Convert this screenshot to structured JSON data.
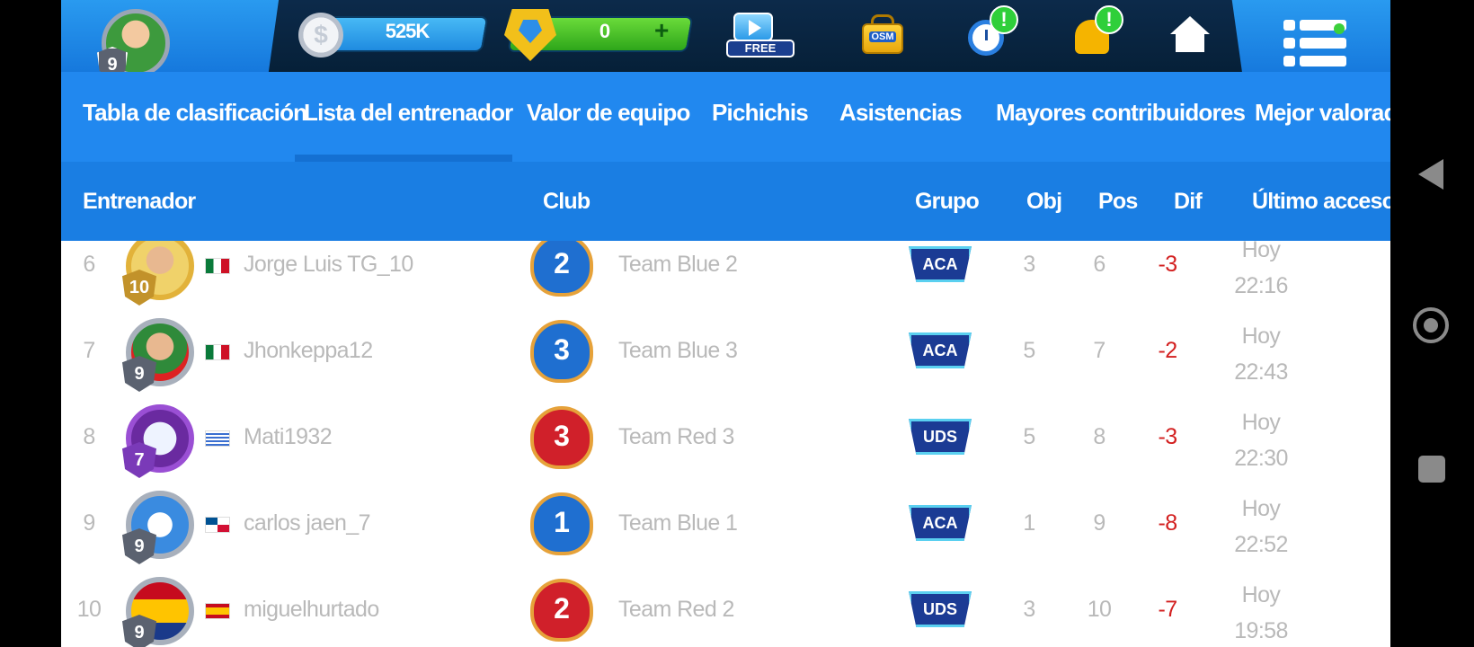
{
  "topbar": {
    "level": "9",
    "coins": "525K",
    "tokens": "0",
    "tokens_plus": "+",
    "free_label": "FREE",
    "osm_label": "OSM",
    "timer_alert": "!",
    "bell_alert": "!",
    "icons": [
      "dollar-coin-icon",
      "token-icon",
      "video-icon",
      "osm-bag-icon",
      "stopwatch-icon",
      "bell-icon",
      "home-icon",
      "menu-icon"
    ]
  },
  "tabs": [
    {
      "label": "Tabla de clasificación"
    },
    {
      "label": "Lista del entrenador",
      "active": true
    },
    {
      "label": "Valor de equipo"
    },
    {
      "label": "Pichichis"
    },
    {
      "label": "Asistencias"
    },
    {
      "label": "Mayores contribuidores"
    },
    {
      "label": "Mejor valorados"
    }
  ],
  "columns": {
    "coach": "Entrenador",
    "club": "Club",
    "group": "Grupo",
    "obj": "Obj",
    "pos": "Pos",
    "dif": "Dif",
    "last_access": "Último acceso"
  },
  "rows": [
    {
      "rank": "6",
      "level": "10",
      "flag": "mexico",
      "name": "Jorge Luis TG_10",
      "shirt_number": "2",
      "shirt_color": "#1f6fd0",
      "club": "Team Blue 2",
      "group": "ACA",
      "obj": "3",
      "pos": "6",
      "dif": "-3",
      "access_day": "Hoy",
      "access_time": "22:16"
    },
    {
      "rank": "7",
      "level": "9",
      "flag": "mexico",
      "name": "Jhonkeppa12",
      "shirt_number": "3",
      "shirt_color": "#1f6fd0",
      "club": "Team Blue 3",
      "group": "ACA",
      "obj": "5",
      "pos": "7",
      "dif": "-2",
      "access_day": "Hoy",
      "access_time": "22:43"
    },
    {
      "rank": "8",
      "level": "7",
      "flag": "uruguay",
      "name": "Mati1932",
      "shirt_number": "3",
      "shirt_color": "#d0202a",
      "club": "Team Red 3",
      "group": "UDS",
      "obj": "5",
      "pos": "8",
      "dif": "-3",
      "access_day": "Hoy",
      "access_time": "22:30"
    },
    {
      "rank": "9",
      "level": "9",
      "flag": "panama",
      "name": "carlos jaen_7",
      "shirt_number": "1",
      "shirt_color": "#1f6fd0",
      "club": "Team Blue 1",
      "group": "ACA",
      "obj": "1",
      "pos": "9",
      "dif": "-8",
      "access_day": "Hoy",
      "access_time": "22:52"
    },
    {
      "rank": "10",
      "level": "9",
      "flag": "spain",
      "name": "miguelhurtado",
      "shirt_number": "2",
      "shirt_color": "#d0202a",
      "club": "Team Red 2",
      "group": "UDS",
      "obj": "3",
      "pos": "10",
      "dif": "-7",
      "access_day": "Hoy",
      "access_time": "19:58"
    }
  ],
  "android_nav": [
    "back-icon",
    "home-circle-icon",
    "recents-icon"
  ]
}
